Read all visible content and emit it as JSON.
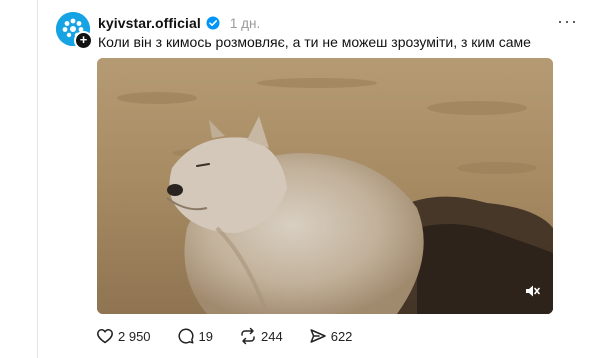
{
  "post": {
    "username": "kyivstar.official",
    "time_ago": "1 дн.",
    "caption": "Коли він з кимось розмовляє, а ти не можеш зрозуміти, з ким саме",
    "avatar_plus": "+",
    "more_glyph": "···"
  },
  "actions": {
    "likes": "2 950",
    "comments": "19",
    "reposts": "244",
    "shares": "622"
  },
  "colors": {
    "brand": "#16a3e3",
    "verified": "#0095f6"
  },
  "icons": {
    "like": "heart-icon",
    "comment": "comment-bubble-icon",
    "repost": "repost-arrows-icon",
    "share": "send-arrow-icon",
    "mute": "speaker-muted-icon",
    "more": "more-dots-icon",
    "verified": "verified-badge-icon"
  }
}
